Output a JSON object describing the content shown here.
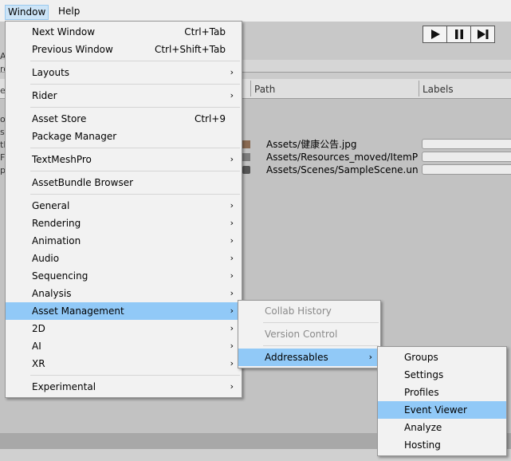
{
  "menubar": {
    "window": "Window",
    "help": "Help"
  },
  "window_menu": {
    "items": [
      {
        "label": "Next Window",
        "shortcut": "Ctrl+Tab"
      },
      {
        "label": "Previous Window",
        "shortcut": "Ctrl+Shift+Tab"
      },
      {
        "label": "Layouts"
      },
      {
        "label": "Rider"
      },
      {
        "label": "Asset Store",
        "shortcut": "Ctrl+9"
      },
      {
        "label": "Package Manager"
      },
      {
        "label": "TextMeshPro"
      },
      {
        "label": "AssetBundle Browser"
      },
      {
        "label": "General"
      },
      {
        "label": "Rendering"
      },
      {
        "label": "Animation"
      },
      {
        "label": "Audio"
      },
      {
        "label": "Sequencing"
      },
      {
        "label": "Analysis"
      },
      {
        "label": "Asset Management"
      },
      {
        "label": "2D"
      },
      {
        "label": "AI"
      },
      {
        "label": "XR"
      },
      {
        "label": "Experimental"
      }
    ]
  },
  "asset_management_menu": {
    "items": [
      {
        "label": "Collab History"
      },
      {
        "label": "Version Control"
      },
      {
        "label": "Addressables"
      }
    ]
  },
  "addressables_menu": {
    "items": [
      {
        "label": "Groups"
      },
      {
        "label": "Settings"
      },
      {
        "label": "Profiles"
      },
      {
        "label": "Event Viewer"
      },
      {
        "label": "Analyze"
      },
      {
        "label": "Hosting"
      }
    ]
  },
  "table": {
    "col_path": "Path",
    "col_labels": "Labels",
    "rows": [
      {
        "path": "Assets/健康公告.jpg"
      },
      {
        "path": "Assets/Resources_moved/ItemPr"
      },
      {
        "path": "Assets/Scenes/SampleScene.unit"
      }
    ]
  },
  "left_edge": [
    "A",
    "ro",
    "e",
    "o",
    "s",
    "tl",
    "F",
    "p"
  ],
  "arrow_glyph": "›",
  "icons": {
    "play": "play-icon",
    "pause": "pause-icon",
    "step": "step-icon",
    "submenu": "chevron-right-icon"
  },
  "colors": {
    "menu_highlight": "#91c9f7",
    "menubar_active": "#cce4f7",
    "menu_bg": "#f2f2f2"
  }
}
